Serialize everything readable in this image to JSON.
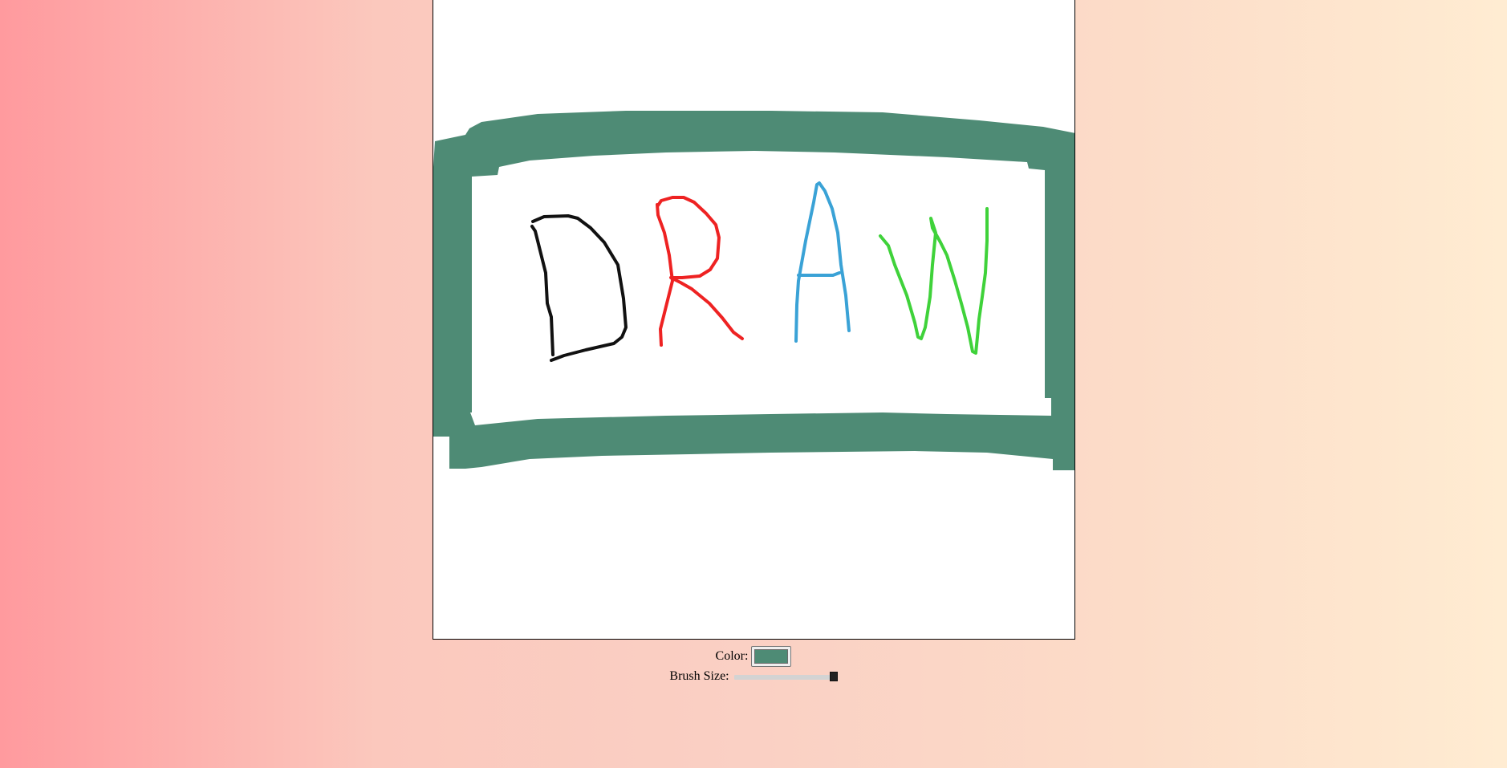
{
  "canvas": {
    "background": "#ffffff",
    "border_color": "#000000"
  },
  "drawing": {
    "letters": [
      "D",
      "R",
      "A",
      "W"
    ],
    "colors": {
      "frame": "#4e8b75",
      "letter_d": "#111111",
      "letter_r": "#ee2222",
      "letter_a": "#3aa2d6",
      "letter_w": "#3fd23a"
    }
  },
  "controls": {
    "color_label": "Color:",
    "color_value": "#4e8b75",
    "brush_label": "Brush Size:",
    "brush_fraction": 1.0
  }
}
